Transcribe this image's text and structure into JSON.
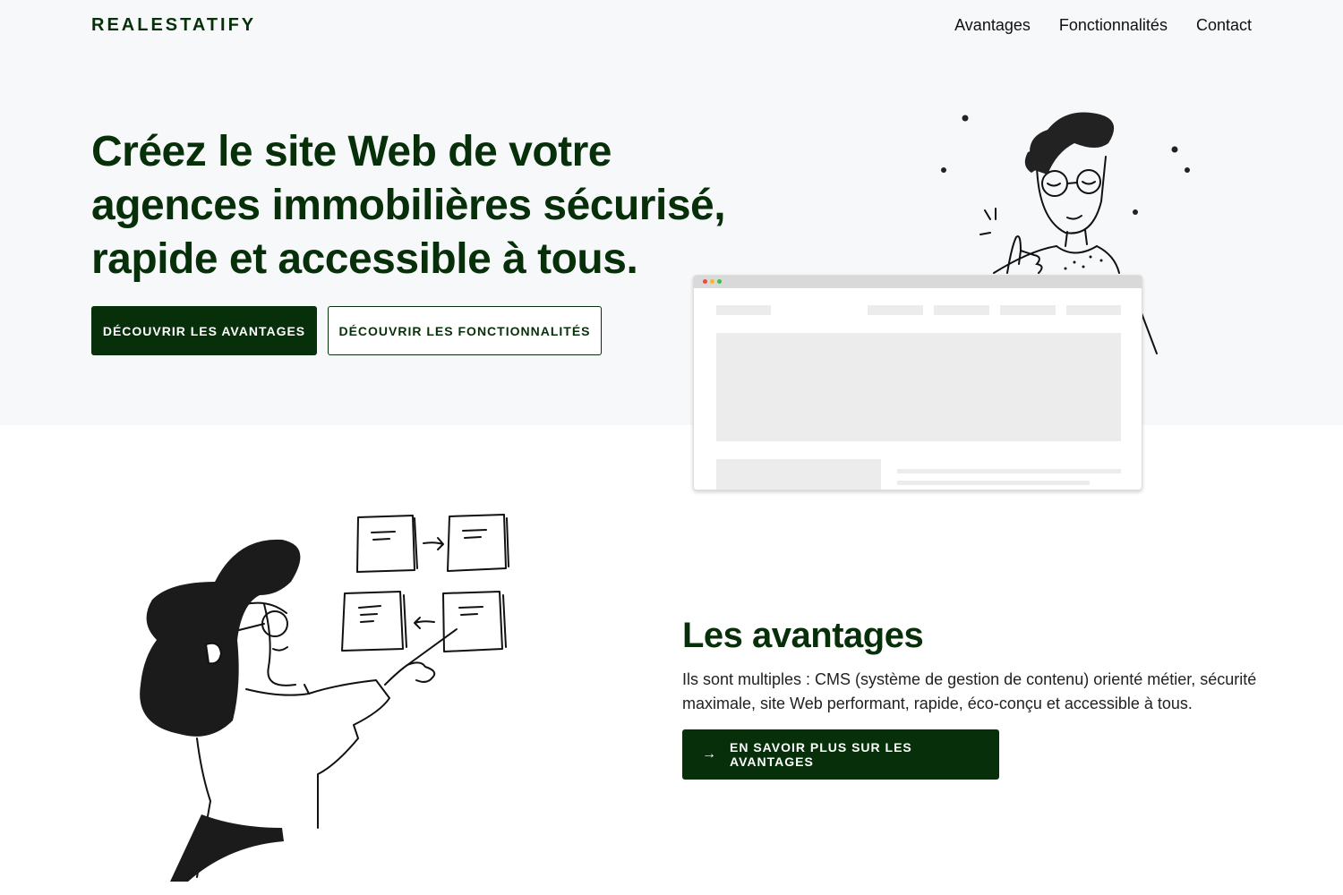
{
  "brand": {
    "name": "REALESTATIFY",
    "color": "#07300a"
  },
  "nav": {
    "items": [
      "Avantages",
      "Fonctionnalités",
      "Contact"
    ]
  },
  "hero": {
    "title": "Créez le site Web de votre agences immobilières sécurisé, rapide et accessible à tous.",
    "primary_button": "DÉCOUVRIR LES AVANTAGES",
    "secondary_button": "DÉCOUVRIR LES FONCTIONNALITÉS"
  },
  "benefits": {
    "title": "Les avantages",
    "text": "Ils sont multiples : CMS (système de gestion de contenu) orienté métier, sécurité maximale, site Web performant, rapide, éco-conçu et accessible à tous.",
    "button": "EN SAVOIR PLUS SUR LES AVANTAGES",
    "button_icon": "arrow-right-icon"
  },
  "colors": {
    "hero_background": "#f7f8fa",
    "accent": "#07300a"
  }
}
